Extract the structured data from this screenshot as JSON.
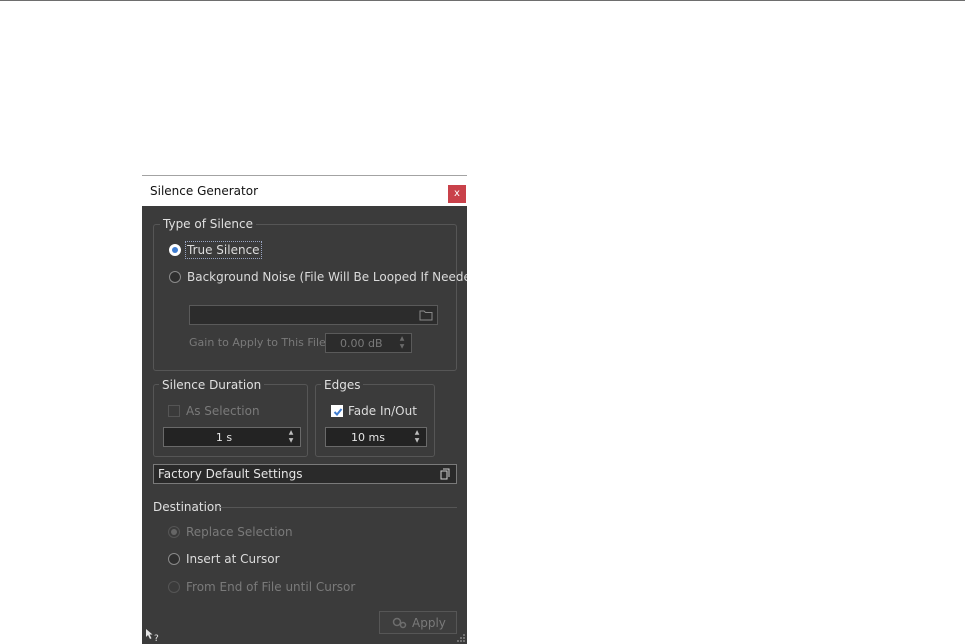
{
  "dialog": {
    "title": "Silence Generator",
    "close_label": "x"
  },
  "type_of_silence": {
    "title": "Type of Silence",
    "true_silence": "True Silence",
    "background_noise": "Background Noise (File Will Be Looped If Needed)",
    "file_path": "",
    "gain_label": "Gain to Apply to This File",
    "gain_value": "0.00 dB"
  },
  "silence_duration": {
    "title": "Silence Duration",
    "as_selection": "As Selection",
    "value": "1 s"
  },
  "edges": {
    "title": "Edges",
    "fade_label": "Fade In/Out",
    "value": "10 ms"
  },
  "preset": {
    "label": "Factory Default Settings"
  },
  "destination": {
    "title": "Destination",
    "replace_selection": "Replace Selection",
    "insert_at_cursor": "Insert at Cursor",
    "from_end_of_file": "From End of File until Cursor"
  },
  "footer": {
    "apply_label": "Apply"
  },
  "icons": {
    "close": "close-icon",
    "folder": "folder-icon",
    "preset": "preset-menu-icon",
    "apply": "gears-icon",
    "help": "help-pointer-icon",
    "grip": "resize-grip-icon"
  },
  "colors": {
    "panel": "#3b3b3b",
    "close": "#c9414a",
    "accent": "#3f7dd1"
  }
}
